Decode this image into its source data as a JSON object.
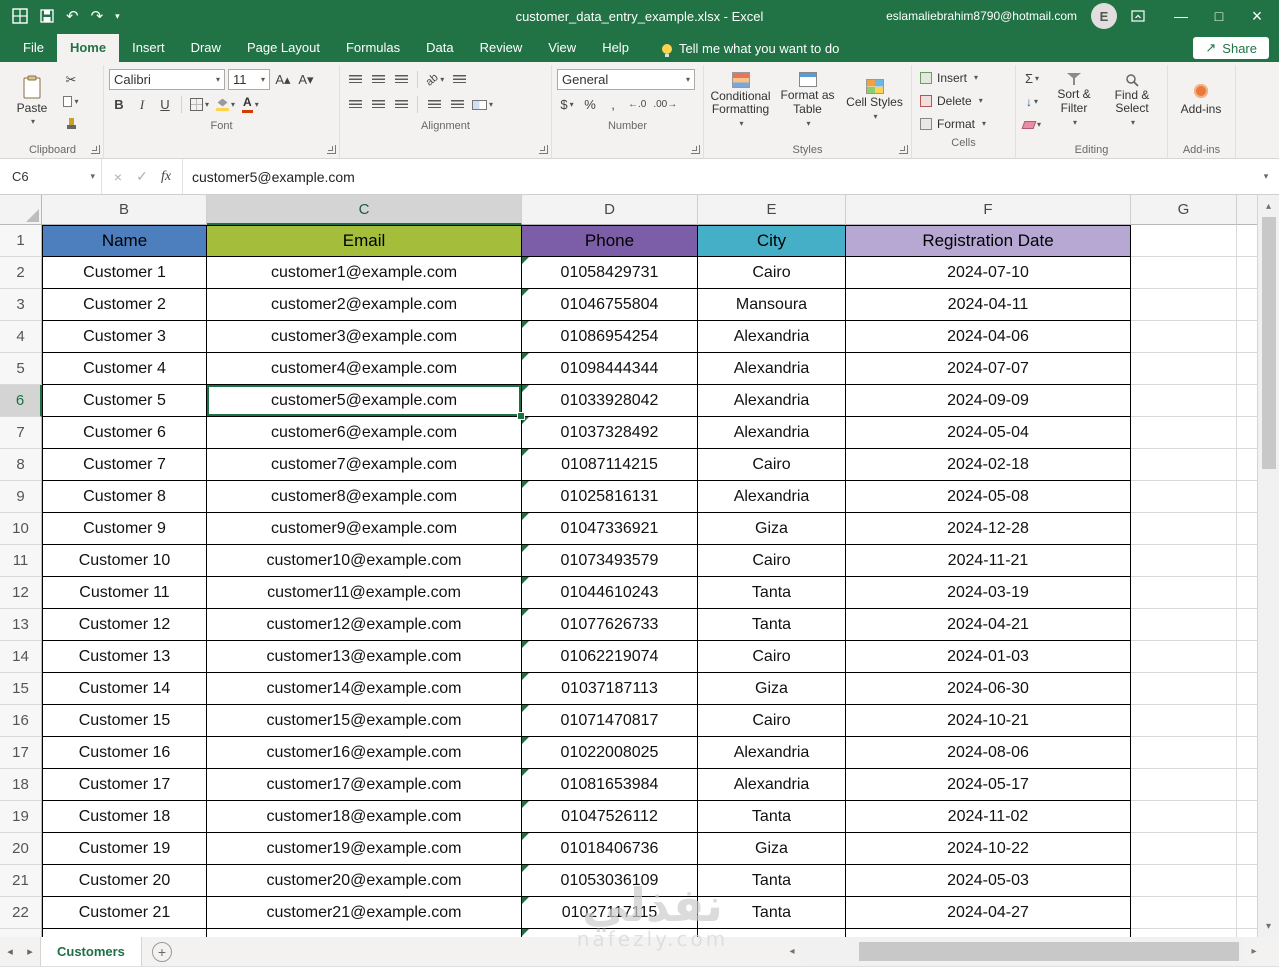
{
  "window": {
    "title": "customer_data_entry_example.xlsx  -  Excel",
    "account_email": "eslamaliebrahim8790@hotmail.com",
    "avatar_initial": "E"
  },
  "icons": {
    "chevron_down": "▾",
    "undo": "↶",
    "redo": "↷",
    "minimize": "—",
    "maximize": "□",
    "close": "×",
    "cancel": "×",
    "check": "✓",
    "scissors": "✂",
    "sum": "Σ",
    "fill_down": "↓",
    "dollar": "$",
    "percent": "%",
    "comma": ",",
    "increase_decimal": "←.0",
    "decrease_decimal": ".00→",
    "grow_font": "A▴",
    "shrink_font": "A▾",
    "font_color_a": "A",
    "orientation": "ab",
    "left": "◂",
    "right": "▸",
    "up": "▴",
    "down": "▾",
    "share": "↗"
  },
  "ribbon": {
    "tabs": [
      "File",
      "Home",
      "Insert",
      "Draw",
      "Page Layout",
      "Formulas",
      "Data",
      "Review",
      "View",
      "Help"
    ],
    "active_tab": "Home",
    "tell_me": "Tell me what you want to do",
    "share": "Share",
    "clipboard": {
      "label": "Clipboard",
      "paste": "Paste"
    },
    "font": {
      "label": "Font",
      "family": "Calibri",
      "size": "11",
      "bold": "B",
      "italic": "I",
      "underline": "U"
    },
    "alignment": {
      "label": "Alignment"
    },
    "number": {
      "label": "Number",
      "format": "General"
    },
    "styles": {
      "label": "Styles",
      "conditional": "Conditional Formatting",
      "format_table": "Format as Table",
      "cell_styles": "Cell Styles"
    },
    "cells": {
      "label": "Cells",
      "insert": "Insert",
      "delete": "Delete",
      "format": "Format"
    },
    "editing": {
      "label": "Editing",
      "sort_filter": "Sort & Filter",
      "find_select": "Find & Select"
    },
    "addins": {
      "label": "Add-ins",
      "button": "Add-ins"
    }
  },
  "formula_bar": {
    "name_box": "C6",
    "fx": "fx",
    "formula": "customer5@example.com"
  },
  "grid": {
    "columns": [
      "B",
      "C",
      "D",
      "E",
      "F",
      "G"
    ],
    "active": {
      "column": "C",
      "row": 6
    },
    "header_row": {
      "n": 1,
      "cells": [
        {
          "label": "Name",
          "color": "#4d7ebd"
        },
        {
          "label": "Email",
          "color": "#a4bd3b"
        },
        {
          "label": "Phone",
          "color": "#7b5ea7"
        },
        {
          "label": "City",
          "color": "#45afc8"
        },
        {
          "label": "Registration Date",
          "color": "#b7a8d3"
        }
      ]
    },
    "rows": [
      {
        "n": 2,
        "name": "Customer 1",
        "email": "customer1@example.com",
        "phone": "01058429731",
        "city": "Cairo",
        "date": "2024-07-10"
      },
      {
        "n": 3,
        "name": "Customer 2",
        "email": "customer2@example.com",
        "phone": "01046755804",
        "city": "Mansoura",
        "date": "2024-04-11"
      },
      {
        "n": 4,
        "name": "Customer 3",
        "email": "customer3@example.com",
        "phone": "01086954254",
        "city": "Alexandria",
        "date": "2024-04-06"
      },
      {
        "n": 5,
        "name": "Customer 4",
        "email": "customer4@example.com",
        "phone": "01098444344",
        "city": "Alexandria",
        "date": "2024-07-07"
      },
      {
        "n": 6,
        "name": "Customer 5",
        "email": "customer5@example.com",
        "phone": "01033928042",
        "city": "Alexandria",
        "date": "2024-09-09"
      },
      {
        "n": 7,
        "name": "Customer 6",
        "email": "customer6@example.com",
        "phone": "01037328492",
        "city": "Alexandria",
        "date": "2024-05-04"
      },
      {
        "n": 8,
        "name": "Customer 7",
        "email": "customer7@example.com",
        "phone": "01087114215",
        "city": "Cairo",
        "date": "2024-02-18"
      },
      {
        "n": 9,
        "name": "Customer 8",
        "email": "customer8@example.com",
        "phone": "01025816131",
        "city": "Alexandria",
        "date": "2024-05-08"
      },
      {
        "n": 10,
        "name": "Customer 9",
        "email": "customer9@example.com",
        "phone": "01047336921",
        "city": "Giza",
        "date": "2024-12-28"
      },
      {
        "n": 11,
        "name": "Customer 10",
        "email": "customer10@example.com",
        "phone": "01073493579",
        "city": "Cairo",
        "date": "2024-11-21"
      },
      {
        "n": 12,
        "name": "Customer 11",
        "email": "customer11@example.com",
        "phone": "01044610243",
        "city": "Tanta",
        "date": "2024-03-19"
      },
      {
        "n": 13,
        "name": "Customer 12",
        "email": "customer12@example.com",
        "phone": "01077626733",
        "city": "Tanta",
        "date": "2024-04-21"
      },
      {
        "n": 14,
        "name": "Customer 13",
        "email": "customer13@example.com",
        "phone": "01062219074",
        "city": "Cairo",
        "date": "2024-01-03"
      },
      {
        "n": 15,
        "name": "Customer 14",
        "email": "customer14@example.com",
        "phone": "01037187113",
        "city": "Giza",
        "date": "2024-06-30"
      },
      {
        "n": 16,
        "name": "Customer 15",
        "email": "customer15@example.com",
        "phone": "01071470817",
        "city": "Cairo",
        "date": "2024-10-21"
      },
      {
        "n": 17,
        "name": "Customer 16",
        "email": "customer16@example.com",
        "phone": "01022008025",
        "city": "Alexandria",
        "date": "2024-08-06"
      },
      {
        "n": 18,
        "name": "Customer 17",
        "email": "customer17@example.com",
        "phone": "01081653984",
        "city": "Alexandria",
        "date": "2024-05-17"
      },
      {
        "n": 19,
        "name": "Customer 18",
        "email": "customer18@example.com",
        "phone": "01047526112",
        "city": "Tanta",
        "date": "2024-11-02"
      },
      {
        "n": 20,
        "name": "Customer 19",
        "email": "customer19@example.com",
        "phone": "01018406736",
        "city": "Giza",
        "date": "2024-10-22"
      },
      {
        "n": 21,
        "name": "Customer 20",
        "email": "customer20@example.com",
        "phone": "01053036109",
        "city": "Tanta",
        "date": "2024-05-03"
      },
      {
        "n": 22,
        "name": "Customer 21",
        "email": "customer21@example.com",
        "phone": "01027117115",
        "city": "Tanta",
        "date": "2024-04-27"
      }
    ]
  },
  "sheet_bar": {
    "active_tab": "Customers",
    "add_sheet": "+"
  },
  "watermark": {
    "line1": "نفذلي",
    "line2": "nafezly.com"
  }
}
